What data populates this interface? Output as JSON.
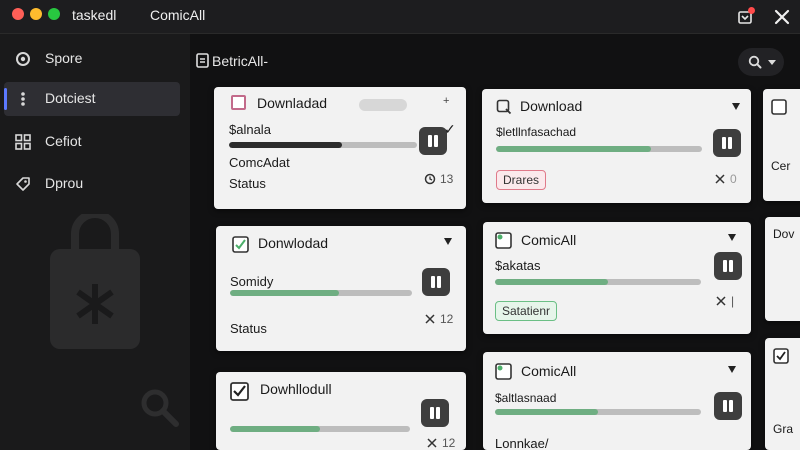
{
  "app": {
    "name": "taskedl",
    "window_title": "ComicAll"
  },
  "sidebar": {
    "items": [
      {
        "label": "Spore",
        "icon": "gear-icon"
      },
      {
        "label": "Dotciest",
        "icon": "dots-icon",
        "active": true
      },
      {
        "label": "Cefiot",
        "icon": "grid-icon"
      },
      {
        "label": "Dprou",
        "icon": "tag-icon"
      }
    ]
  },
  "main": {
    "title": "BetricAll-"
  },
  "cards": [
    {
      "title": "Downladad",
      "line1": "$alnala",
      "line2": "ComcAdat",
      "line3": "Status",
      "meta": "13",
      "progress": 0.6
    },
    {
      "title": "Download",
      "line1": "$letllnfasachad",
      "badge": "Drares",
      "meta": "0",
      "progress": 0.75
    },
    {
      "title": "Donwlodad",
      "line1": "Somidy",
      "line3": "Status",
      "meta": "12",
      "progress": 0.6
    },
    {
      "title": "ComicAll",
      "line1": "$akatas",
      "badge": "Satatienr",
      "progress": 0.55
    },
    {
      "title": "Dowhllodull",
      "meta": "12",
      "progress": 0.5
    },
    {
      "title": "ComicAll",
      "line1": "$altlasnaad",
      "line3": "Lonnkae/",
      "progress": 0.5
    },
    {
      "line2": "Cer"
    },
    {
      "line1": "Dov"
    },
    {
      "line3": "Gra"
    }
  ],
  "colors": {
    "progress_dark": "#2d2d2d",
    "progress_green": "#6fae82",
    "accent": "#5c79ff"
  }
}
